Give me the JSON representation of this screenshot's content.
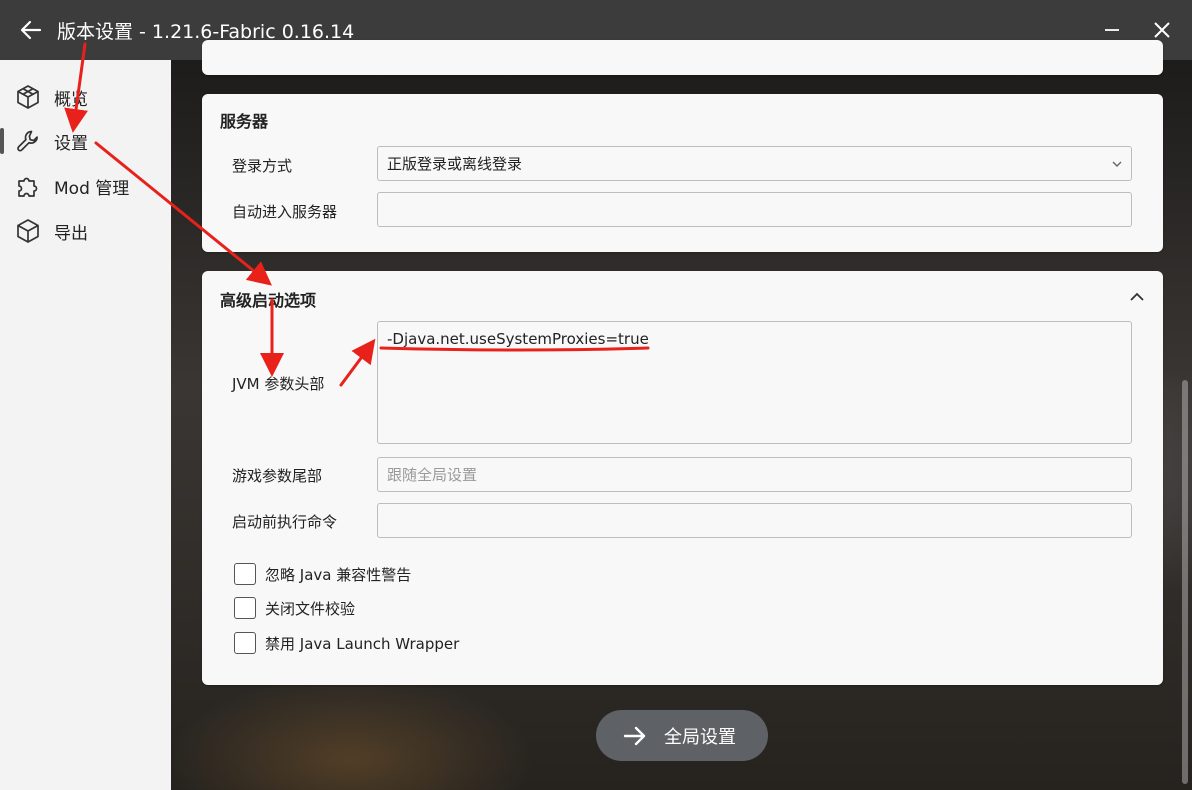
{
  "titlebar": {
    "title": "版本设置 - 1.21.6-Fabric 0.16.14"
  },
  "sidebar": {
    "items": [
      {
        "label": "概览",
        "icon": "cube-outline-icon"
      },
      {
        "label": "设置",
        "icon": "wrench-icon"
      },
      {
        "label": "Mod 管理",
        "icon": "puzzle-icon"
      },
      {
        "label": "导出",
        "icon": "package-icon"
      }
    ],
    "active_index": 1
  },
  "server_card": {
    "title": "服务器",
    "login_label": "登录方式",
    "login_value": "正版登录或离线登录",
    "auto_join_label": "自动进入服务器",
    "auto_join_value": ""
  },
  "advanced_card": {
    "title": "高级启动选项",
    "jvm_label": "JVM 参数头部",
    "jvm_value": "-Djava.net.useSystemProxies=true",
    "game_args_label": "游戏参数尾部",
    "game_args_placeholder": "跟随全局设置",
    "pre_launch_label": "启动前执行命令",
    "pre_launch_value": "",
    "checkboxes": [
      {
        "label": "忽略 Java 兼容性警告",
        "checked": false
      },
      {
        "label": "关闭文件校验",
        "checked": false
      },
      {
        "label": "禁用 Java Launch Wrapper",
        "checked": false
      }
    ]
  },
  "global_button": {
    "label": "全局设置"
  },
  "colors": {
    "annotation": "#e8221b",
    "button_bg": "#5e6166",
    "card_bg": "#f8f8f8",
    "sidebar_bg": "#f3f3f3",
    "titlebar_bg": "#3c3c3c"
  }
}
